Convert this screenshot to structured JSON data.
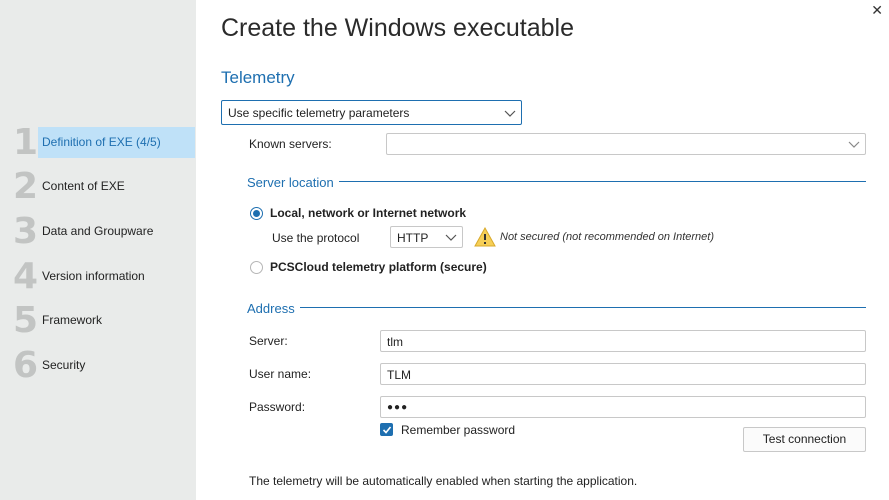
{
  "window": {
    "close_glyph": "✕"
  },
  "sidebar": {
    "steps": [
      {
        "num": "1",
        "label": "Definition of EXE (4/5)",
        "active": true
      },
      {
        "num": "2",
        "label": "Content of EXE"
      },
      {
        "num": "3",
        "label": "Data and Groupware"
      },
      {
        "num": "4",
        "label": "Version information"
      },
      {
        "num": "5",
        "label": "Framework"
      },
      {
        "num": "6",
        "label": "Security"
      }
    ]
  },
  "main": {
    "title": "Create the Windows executable",
    "section": "Telemetry",
    "telemetry_mode": "Use specific telemetry parameters",
    "known_servers_label": "Known servers:",
    "known_servers_value": "",
    "server_location": {
      "title": "Server location",
      "option_local": "Local, network or Internet network",
      "protocol_label": "Use the protocol",
      "protocol_value": "HTTP",
      "warning_icon": "warning-triangle-icon",
      "warning_text": "Not secured (not recommended on Internet)",
      "option_cloud": "PCSCloud telemetry platform (secure)",
      "selected": "local"
    },
    "address": {
      "title": "Address",
      "server_label": "Server:",
      "server_value": "tlm",
      "username_label": "User name:",
      "username_value": "TLM",
      "password_label": "Password:",
      "password_value": "●●●",
      "remember_label": "Remember password",
      "remember_checked": true,
      "test_button": "Test connection"
    },
    "footer_note": "The telemetry will be automatically enabled when starting the application."
  },
  "colors": {
    "accent": "#1e6fb0",
    "sidebar_bg": "#e9ebea",
    "active_bg": "#bfe1f8",
    "step_number": "#c2c4c3"
  }
}
